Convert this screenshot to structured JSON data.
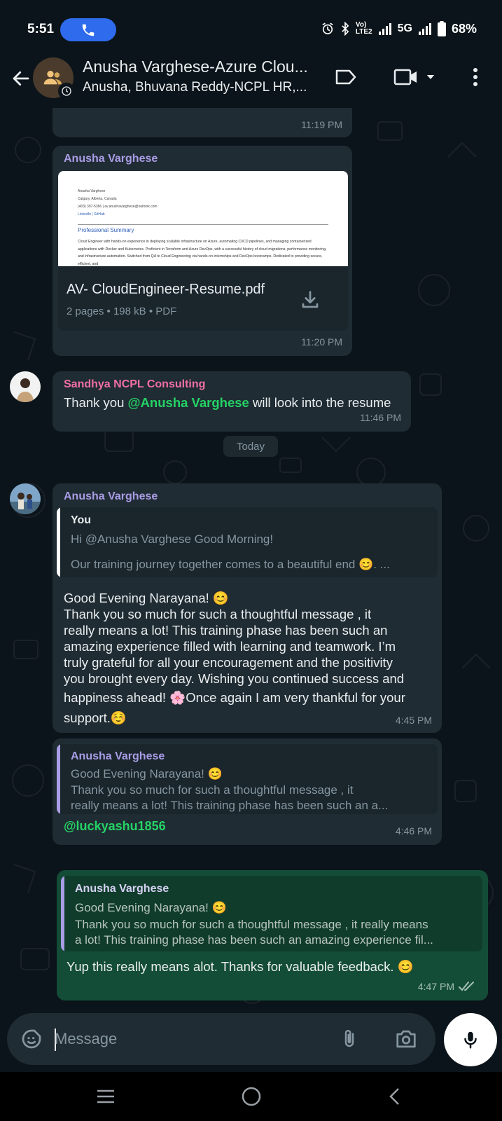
{
  "status_bar": {
    "time": "5:51",
    "network": "5G",
    "battery": "68%"
  },
  "header": {
    "title": "Anusha Varghese-Azure Clou...",
    "subtitle": "Anusha, Bhuvana Reddy-NCPL HR,..."
  },
  "messages": {
    "m0": {
      "time": "11:19 PM"
    },
    "m1": {
      "sender": "Anusha Varghese",
      "doc_preview": {
        "name_line": "Anusha Varghese",
        "location": "Calgary, Alberta, Canada",
        "contact": "(403) 397-5366 | av.anushavarghese@outlook.com",
        "links": "LinkedIn | GitHub",
        "section": "Professional Summary",
        "summary": "Cloud Engineer with hands-on experience in deploying scalable infrastructure on Azure, automating CI/CD pipelines, and managing containerized applications with Docker and Kubernetes. Proficient in Terraform and Azure DevOps, with a successful history of cloud migrations, performance monitoring, and infrastructure automation. Switched from QA to Cloud Engineering via hands-on internships and DevOps bootcamps. Dedicated to providing secure, efficient, and"
      },
      "file_name": "AV- CloudEngineer-Resume.pdf",
      "file_meta": "2 pages • 198 kB • PDF",
      "time": "11:20 PM"
    },
    "m2": {
      "sender": "Sandhya NCPL Consulting",
      "text_before": "Thank you ",
      "mention": "@Anusha Varghese",
      "text_after": " will look into the resume",
      "time": "11:46 PM"
    },
    "day_divider": "Today",
    "m3": {
      "sender": "Anusha Varghese",
      "quote_name": "You",
      "quote_line1": "Hi @Anusha Varghese Good Morning!",
      "quote_line2": "Our training journey together comes to a beautiful end 😊. ...",
      "line1": "Good Evening Narayana! 😊",
      "line2": "Thank you so much for such a thoughtful message , it",
      "line3": "really means a lot! This training phase has been such an",
      "line4": "amazing experience filled with learning and teamwork. I’m",
      "line5": "truly grateful for all your encouragement and the positivity",
      "line6": "you brought every day. Wishing you continued success and",
      "line7": "happiness ahead! 🌸Once again I am very thankful for your",
      "line8": "support.☺️",
      "time": "4:45 PM"
    },
    "m4": {
      "quote_name": "Anusha Varghese",
      "quote_line1": "Good Evening Narayana! 😊",
      "quote_line2": "Thank you so much for such a thoughtful message , it",
      "quote_line3": "really means a lot! This training phase has been such an a...",
      "mention": "@luckyashu1856",
      "time": "4:46 PM"
    },
    "m5": {
      "quote_name": "Anusha Varghese",
      "quote_line1": "Good Evening Narayana! 😊",
      "quote_line2": "Thank you so much for such a thoughtful message , it really means",
      "quote_line3": "a lot! This training phase has been such an amazing experience fil...",
      "text": "Yup this really means alot. Thanks for valuable feedback. 😊",
      "time": "4:47 PM"
    }
  },
  "composer": {
    "placeholder": "Message"
  },
  "colors": {
    "background": "#0b141a",
    "incoming": "#202c33",
    "outgoing": "#144d37",
    "mention": "#25d366",
    "sender_purple": "#a99de6",
    "sender_pink": "#ef6fa4"
  }
}
